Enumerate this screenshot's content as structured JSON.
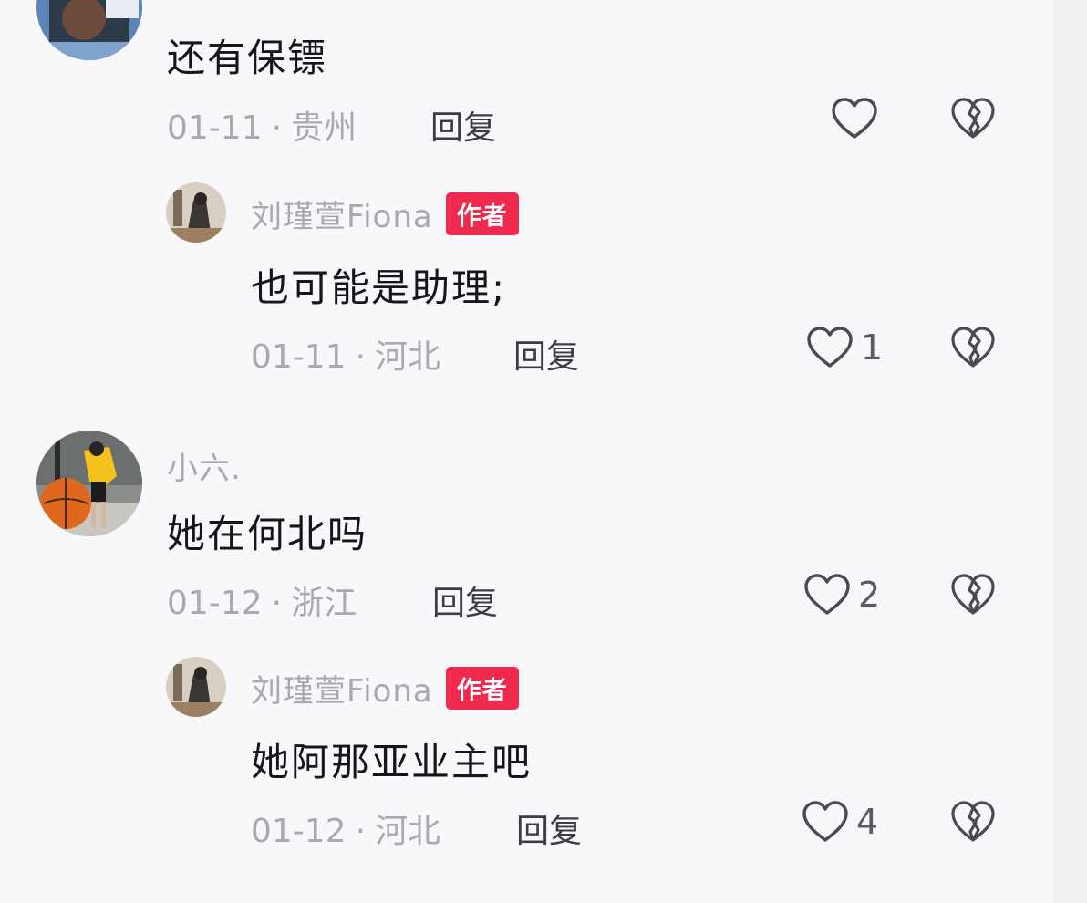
{
  "comments": [
    {
      "username": "",
      "text": "还有保镖",
      "date": "01-11",
      "location": "贵州",
      "reply_label": "回复",
      "likes": "",
      "replies": [
        {
          "username": "刘瑾萱Fiona",
          "badge": "作者",
          "text": "也可能是助理;",
          "date": "01-11",
          "location": "河北",
          "reply_label": "回复",
          "likes": "1"
        }
      ]
    },
    {
      "username": "小六.",
      "text": "她在何北吗",
      "date": "01-12",
      "location": "浙江",
      "reply_label": "回复",
      "likes": "2",
      "replies": [
        {
          "username": "刘瑾萱Fiona",
          "badge": "作者",
          "text": "她阿那亚业主吧",
          "date": "01-12",
          "location": "河北",
          "reply_label": "回复",
          "likes": "4"
        }
      ]
    }
  ],
  "meta_separator": "·",
  "icons": {
    "like": "heart-outline-icon",
    "dislike": "broken-heart-icon"
  },
  "colors": {
    "badge": "#f0294f",
    "meta": "#a9a9b2",
    "text": "#16161a",
    "background": "#f8f8fa"
  }
}
